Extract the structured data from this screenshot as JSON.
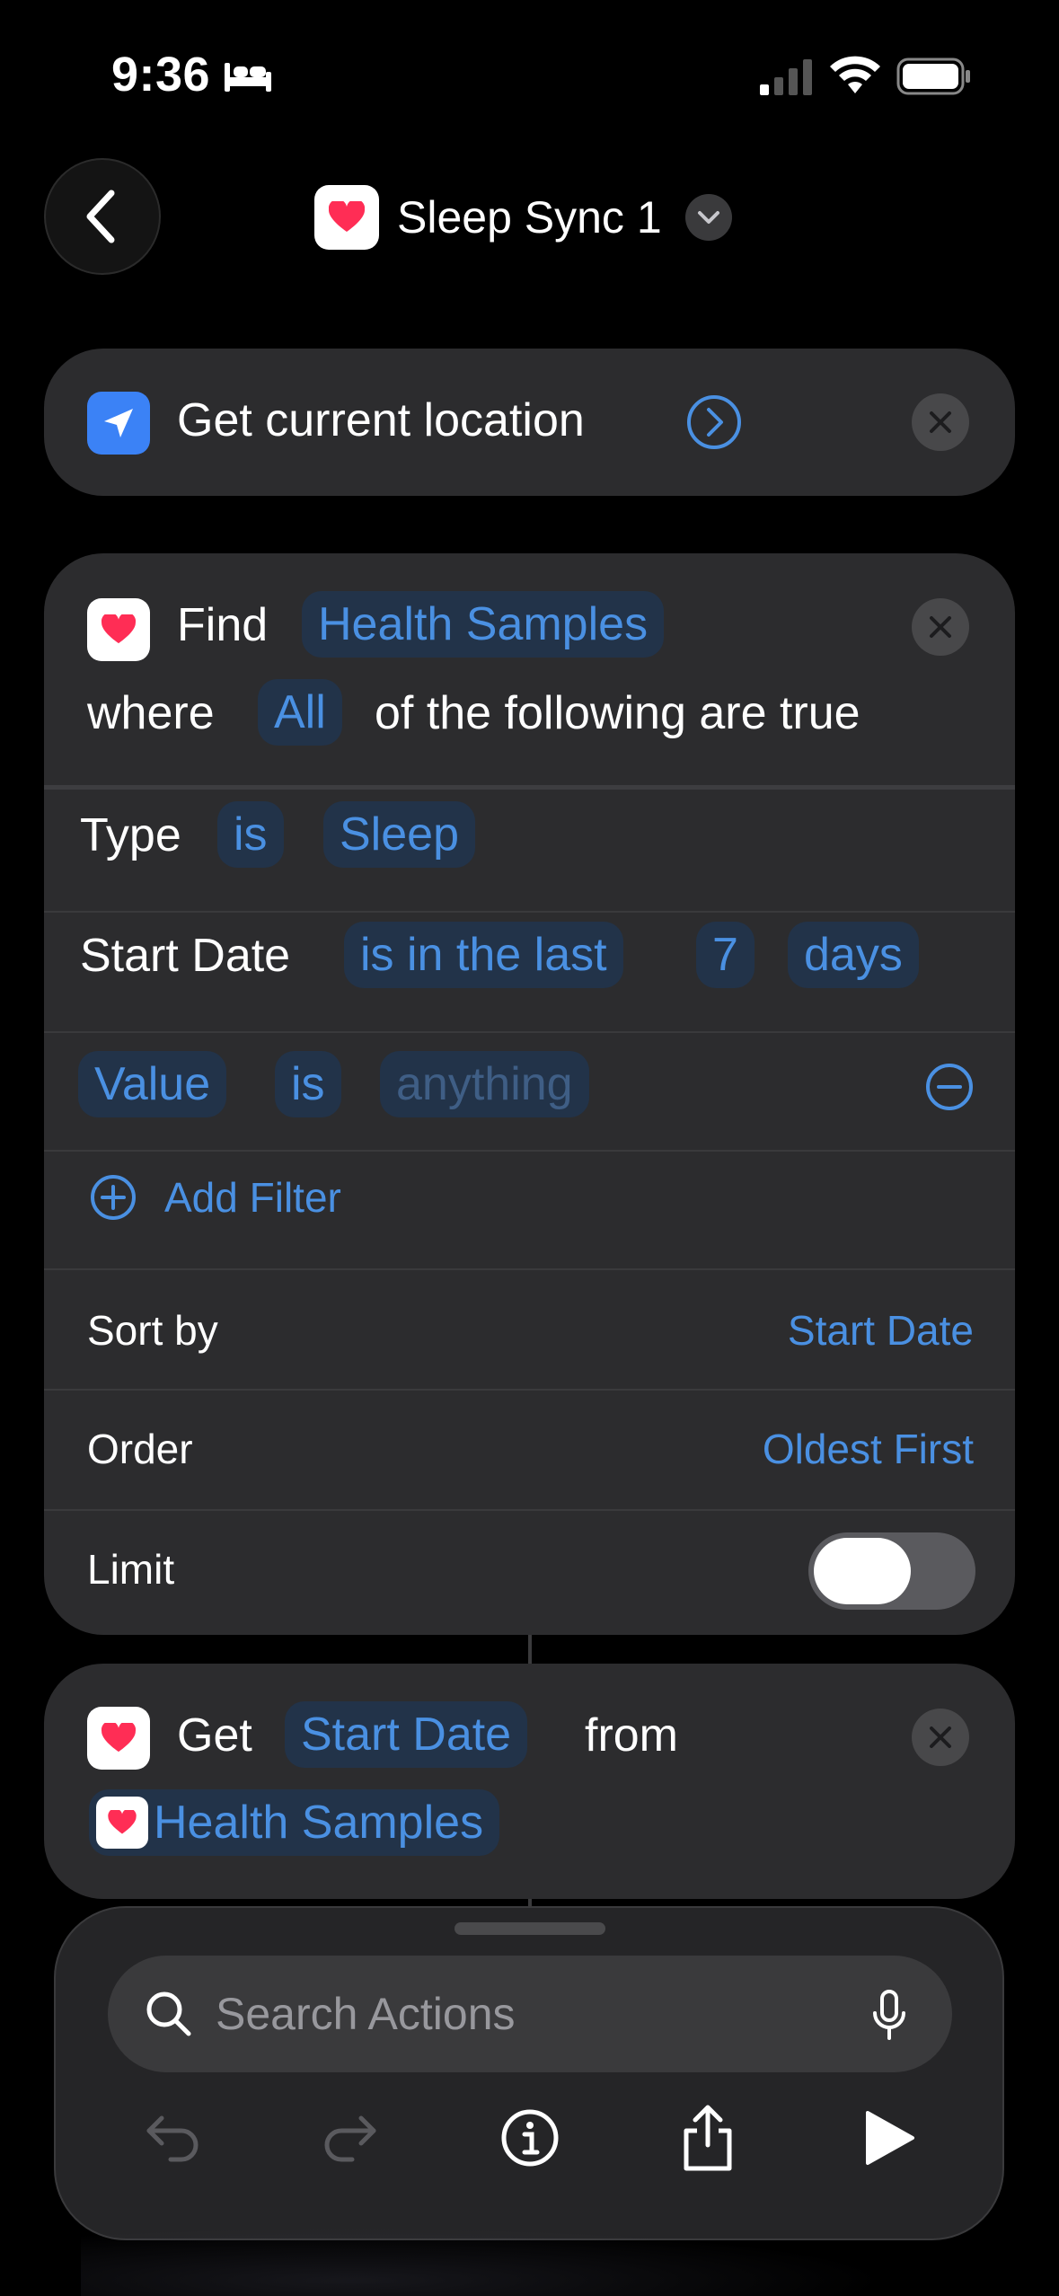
{
  "status_bar": {
    "time": "9:36"
  },
  "nav": {
    "title": "Sleep Sync 1"
  },
  "action1": {
    "label": "Get current location"
  },
  "find": {
    "verb": "Find",
    "item": "Health Samples",
    "where": "where",
    "quantifier": "All",
    "suffix": "of the following are true",
    "filters": [
      {
        "field": "Type",
        "op": "is",
        "value": "Sleep"
      },
      {
        "field": "Start Date",
        "op": "is in the last",
        "count": "7",
        "unit": "days"
      },
      {
        "field": "Value",
        "op": "is",
        "value": "anything"
      }
    ],
    "add_filter": "Add Filter",
    "sort_by_label": "Sort by",
    "sort_by_value": "Start Date",
    "order_label": "Order",
    "order_value": "Oldest First",
    "limit_label": "Limit"
  },
  "get": {
    "verb": "Get",
    "property": "Start Date",
    "from": "from",
    "source": "Health Samples"
  },
  "sheet": {
    "search_placeholder": "Search Actions"
  },
  "colors": {
    "accent": "#4a90e2",
    "card": "#2c2c2e",
    "background": "#000000"
  }
}
